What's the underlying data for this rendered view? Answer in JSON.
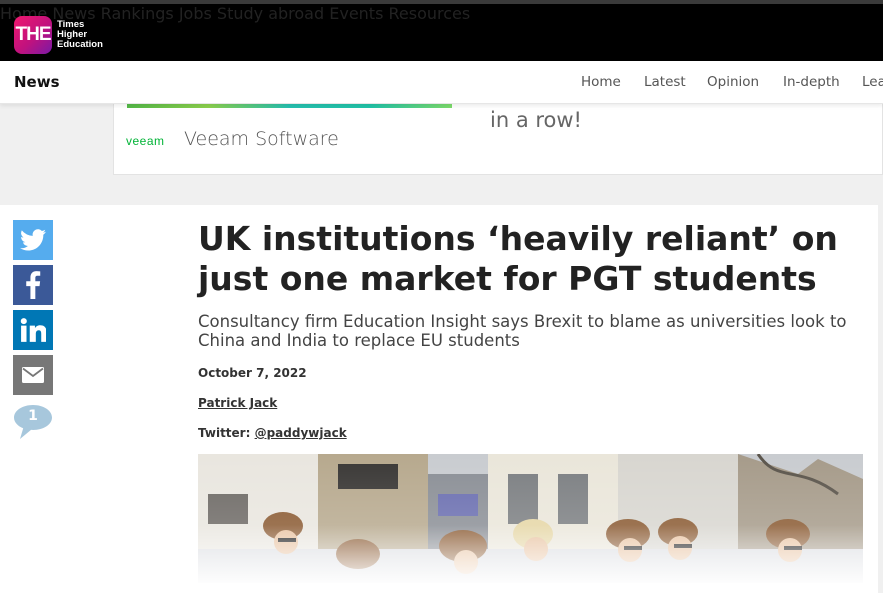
{
  "brand": {
    "mark": "THE",
    "name_lines": [
      "Times",
      "Higher",
      "Education"
    ]
  },
  "main_nav": [
    "Home",
    "News",
    "Rankings",
    "Jobs",
    "Study abroad",
    "Events",
    "Resources"
  ],
  "section": {
    "title": "News",
    "nav": [
      "Home",
      "Latest",
      "Opinion",
      "In-depth",
      "Lea"
    ]
  },
  "ad": {
    "logo": "veeam",
    "company": "Veeam Software",
    "tagline": "in a row!"
  },
  "article": {
    "headline": "UK institutions ‘heavily reliant’ on just one market for PGT students",
    "standfirst": "Consultancy firm Education Insight says Brexit to blame as universities look to China and India to replace EU students",
    "date": "October 7, 2022",
    "author": "Patrick Jack",
    "twitter_label": "Twitter:",
    "twitter_handle": "@paddywjack",
    "comment_count": "1"
  },
  "share_icons": [
    "twitter-icon",
    "facebook-icon",
    "linkedin-icon",
    "email-icon"
  ],
  "colors": {
    "twitter": "#55acee",
    "facebook": "#3b5998",
    "linkedin": "#0077b5",
    "email": "#777777",
    "comment": "#a7c7dc"
  }
}
